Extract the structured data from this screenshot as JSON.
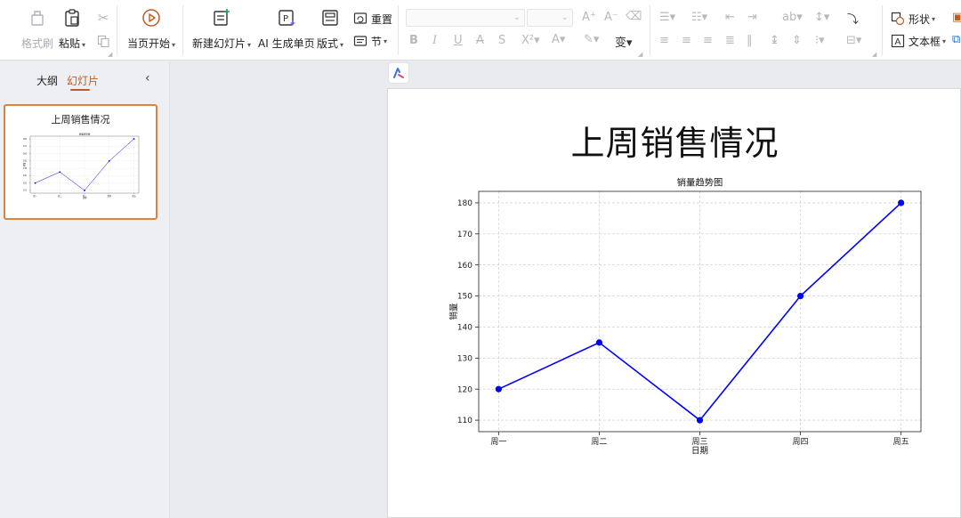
{
  "ribbon": {
    "format_painter": "格式刷",
    "paste": "粘贴",
    "play_from_current": "当页开始",
    "new_slide": "新建幻灯片",
    "ai_generate": "AI 生成单页",
    "layout": "版式",
    "reset": "重置",
    "section": "节",
    "shape": "形状",
    "textbox": "文本框"
  },
  "left_panel": {
    "tab_outline": "大纲",
    "tab_slides": "幻灯片",
    "thumbnail_title": "上周销售情况"
  },
  "slide": {
    "title": "上周销售情况"
  },
  "chart_data": {
    "type": "line",
    "title": "销量趋势图",
    "xlabel": "日期",
    "ylabel": "销量",
    "categories": [
      "周一",
      "周二",
      "周三",
      "周四",
      "周五"
    ],
    "values": [
      120,
      135,
      110,
      150,
      180
    ],
    "yticks": [
      110,
      120,
      130,
      140,
      150,
      160,
      170,
      180
    ],
    "ylim": [
      106.3,
      183.7
    ],
    "grid": true,
    "color": "#0000ff"
  },
  "colors": {
    "accent": "#c05b22",
    "selection_border": "#d9843f",
    "series": "#0000ff"
  }
}
